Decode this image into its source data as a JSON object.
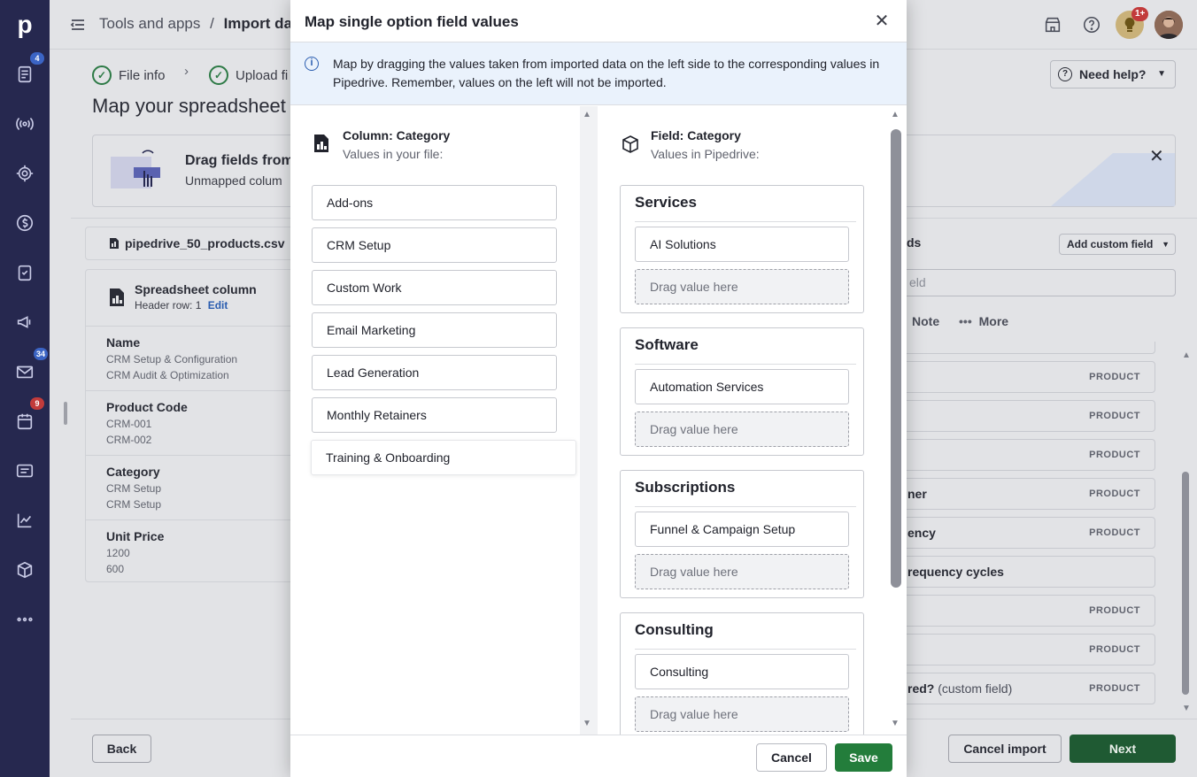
{
  "sidebar": {
    "logo": "p",
    "badges": {
      "leads": "4",
      "mail": "34",
      "activities": "9"
    }
  },
  "topbar": {
    "breadcrumb_root": "Tools and apps",
    "breadcrumb_sep": "/",
    "breadcrumb_current": "Import dat",
    "notif_badge": "1+"
  },
  "steps": {
    "step1": "File info",
    "step2": "Upload fi"
  },
  "page": {
    "title": "Map your spreadsheet",
    "need_help": "Need help?",
    "banner_title": "Drag fields from",
    "banner_sub": "Unmapped colum"
  },
  "spreadsheet": {
    "file_name": "pipedrive_50_products.csv",
    "card_title": "Spreadsheet column",
    "header_row": "Header row: 1",
    "edit": "Edit",
    "fields": [
      {
        "name": "Name",
        "v1": "CRM Setup & Configuration",
        "v2": "CRM Audit & Optimization"
      },
      {
        "name": "Product Code",
        "v1": "CRM-001",
        "v2": "CRM-002"
      },
      {
        "name": "Category",
        "v1": "CRM Setup",
        "v2": "CRM Setup"
      },
      {
        "name": "Unit Price",
        "v1": "1200",
        "v2": "600"
      }
    ]
  },
  "right_panel": {
    "title_partial": "ds",
    "add_custom_field": "Add custom field",
    "search_placeholder": "eld",
    "tab_note": "Note",
    "tab_more": "More",
    "rows": [
      {
        "label": "",
        "tag": "PRODUCT"
      },
      {
        "label": "",
        "tag": "PRODUCT"
      },
      {
        "label": "",
        "tag": "PRODUCT"
      },
      {
        "label": "ner",
        "tag": "PRODUCT"
      },
      {
        "label": "ency",
        "tag": "PRODUCT"
      },
      {
        "label": "requency cycles",
        "tag": ""
      },
      {
        "label": "",
        "tag": "PRODUCT"
      },
      {
        "label": "",
        "tag": "PRODUCT"
      },
      {
        "label": "red?",
        "label_extra": "(custom field)",
        "tag": "PRODUCT"
      }
    ]
  },
  "footer": {
    "back": "Back",
    "cancel_import": "Cancel import",
    "next": "Next"
  },
  "modal": {
    "title": "Map single option field values",
    "info": "Map by dragging the values taken from imported data on the left side to the corresponding values in Pipedrive. Remember, values on the left will not be imported.",
    "left_heading": "Column: Category",
    "left_sub": "Values in your file:",
    "right_heading": "Field: Category",
    "right_sub": "Values in Pipedrive:",
    "file_values": [
      "Add-ons",
      "CRM Setup",
      "Custom Work",
      "Email Marketing",
      "Lead Generation",
      "Monthly Retainers",
      "Training & Onboarding"
    ],
    "groups": [
      {
        "title": "Services",
        "value": "AI Solutions",
        "drop": "Drag value here"
      },
      {
        "title": "Software",
        "value": "Automation Services",
        "drop": "Drag value here"
      },
      {
        "title": "Subscriptions",
        "value": "Funnel & Campaign Setup",
        "drop": "Drag value here"
      },
      {
        "title": "Consulting",
        "value": "Consulting",
        "drop": "Drag value here"
      }
    ],
    "cancel": "Cancel",
    "save": "Save"
  }
}
